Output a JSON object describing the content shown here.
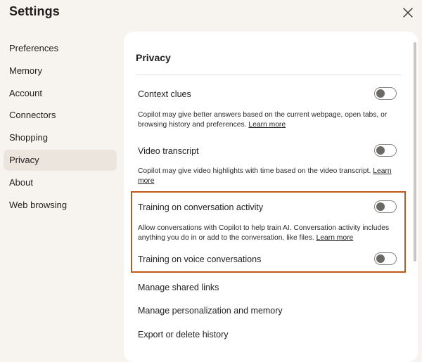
{
  "header": {
    "title": "Settings"
  },
  "sidebar": {
    "items": [
      {
        "label": "Preferences",
        "active": false
      },
      {
        "label": "Memory",
        "active": false
      },
      {
        "label": "Account",
        "active": false
      },
      {
        "label": "Connectors",
        "active": false
      },
      {
        "label": "Shopping",
        "active": false
      },
      {
        "label": "Privacy",
        "active": true
      },
      {
        "label": "About",
        "active": false
      },
      {
        "label": "Web browsing",
        "active": false
      }
    ]
  },
  "privacy": {
    "title": "Privacy",
    "context_clues": {
      "label": "Context clues",
      "desc": "Copilot may give better answers based on the current webpage, open tabs, or browsing history and preferences.",
      "learn_more": "Learn more",
      "enabled": false
    },
    "video_transcript": {
      "label": "Video transcript",
      "desc": "Copilot may give video highlights with time based on the video transcript.",
      "learn_more": "Learn more",
      "enabled": false
    },
    "training_conversation": {
      "label": "Training on conversation activity",
      "desc": "Allow conversations with Copilot to help train AI. Conversation activity includes anything you do in or add to the conversation, like files.",
      "learn_more": "Learn more",
      "enabled": false
    },
    "training_voice": {
      "label": "Training on voice conversations",
      "enabled": false
    },
    "links": {
      "shared_links": "Manage shared links",
      "personalization": "Manage personalization and memory",
      "export_delete": "Export or delete history"
    }
  },
  "colors": {
    "background": "#f7f3ee",
    "panel": "#ffffff",
    "active_nav": "#ebe5dd",
    "highlight_border": "#c0581a",
    "toggle_off": "#6b6966"
  },
  "icons": {
    "close": "close-icon"
  }
}
